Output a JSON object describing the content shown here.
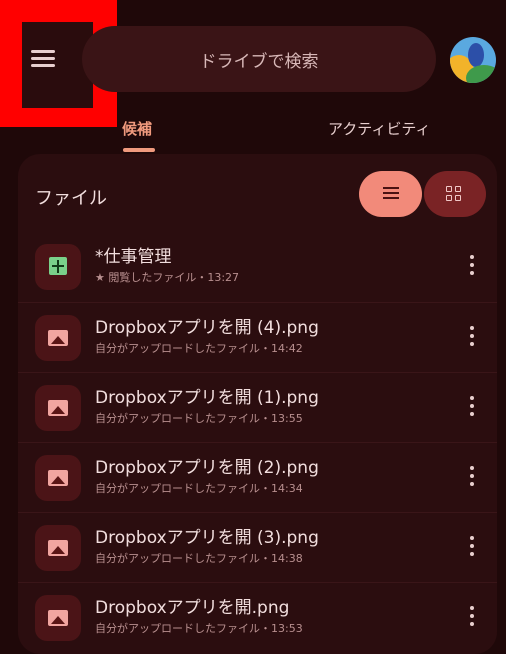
{
  "search": {
    "placeholder": "ドライブで検索"
  },
  "tabs": [
    {
      "label": "候補",
      "active": true
    },
    {
      "label": "アクティビティ",
      "active": false
    }
  ],
  "section": {
    "title": "ファイル"
  },
  "view_toggle": {
    "selected": "list"
  },
  "files": [
    {
      "name": "*仕事管理",
      "detail": "★ 閲覧したファイル・13:27",
      "icon": "sheets-icon"
    },
    {
      "name": "Dropboxアプリを開 (4).png",
      "detail": "自分がアップロードしたファイル・14:42",
      "icon": "image-icon"
    },
    {
      "name": "Dropboxアプリを開 (1).png",
      "detail": "自分がアップロードしたファイル・13:55",
      "icon": "image-icon"
    },
    {
      "name": "Dropboxアプリを開 (2).png",
      "detail": "自分がアップロードしたファイル・14:34",
      "icon": "image-icon"
    },
    {
      "name": "Dropboxアプリを開 (3).png",
      "detail": "自分がアップロードしたファイル・14:38",
      "icon": "image-icon"
    },
    {
      "name": "Dropboxアプリを開.png",
      "detail": "自分がアップロードしたファイル・13:53",
      "icon": "image-icon"
    }
  ],
  "colors": {
    "background": "#1f0809",
    "accent": "#f09a7e",
    "highlight_box": "#ff0000"
  }
}
